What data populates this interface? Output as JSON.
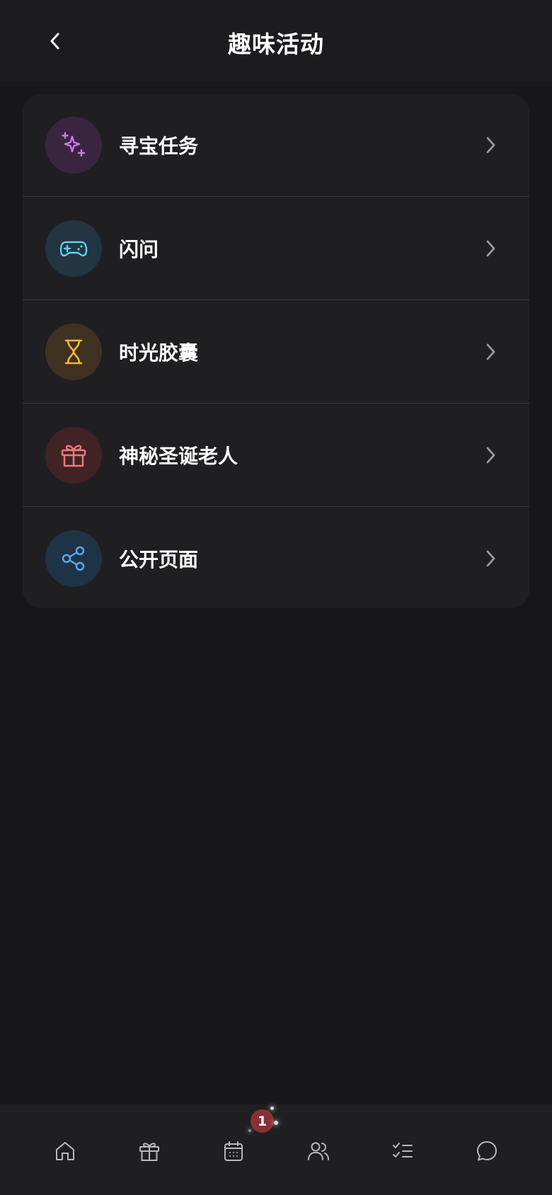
{
  "header": {
    "title": "趣味活动",
    "back_icon": "chevron-left-icon"
  },
  "menu": {
    "items": [
      {
        "label": "寻宝任务",
        "icon": "sparkles-icon",
        "icon_color": "#c77be6",
        "bg_color": "#3a2540"
      },
      {
        "label": "闪问",
        "icon": "gamepad-icon",
        "icon_color": "#5fd3ea",
        "bg_color": "#223540"
      },
      {
        "label": "时光胶囊",
        "icon": "hourglass-icon",
        "icon_color": "#f2b63a",
        "bg_color": "#3f3120"
      },
      {
        "label": "神秘圣诞老人",
        "icon": "gift-icon",
        "icon_color": "#f07a7a",
        "bg_color": "#412325"
      },
      {
        "label": "公开页面",
        "icon": "share-icon",
        "icon_color": "#5aa9f2",
        "bg_color": "#1f3346"
      }
    ]
  },
  "tabbar": {
    "tabs": [
      {
        "icon": "home-icon"
      },
      {
        "icon": "gift-icon"
      },
      {
        "icon": "calendar-icon"
      },
      {
        "icon": "users-icon"
      },
      {
        "icon": "checklist-icon"
      },
      {
        "icon": "chat-bubble-icon"
      }
    ],
    "badge_count": "1",
    "badge_color": "#8a2f36"
  },
  "colors": {
    "background": "#171719",
    "header_bg": "#1c1c1f",
    "card_bg": "#1f1f22",
    "divider": "#3a3a3e",
    "chevron": "#9a9aa0",
    "tab_icon": "#b8b8bd"
  }
}
